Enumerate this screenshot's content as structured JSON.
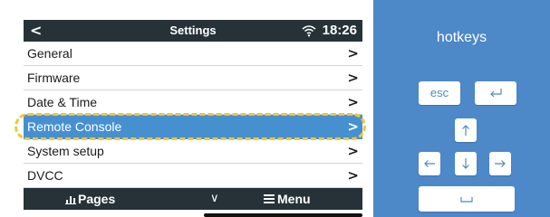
{
  "header": {
    "back_glyph": "<",
    "title": "Settings",
    "time": "18:26"
  },
  "menu": {
    "items": [
      {
        "label": "General",
        "chevron": ">"
      },
      {
        "label": "Firmware",
        "chevron": ">"
      },
      {
        "label": "Date & Time",
        "chevron": ">"
      },
      {
        "label": "Remote Console",
        "chevron": ">"
      },
      {
        "label": "System setup",
        "chevron": ">"
      },
      {
        "label": "DVCC",
        "chevron": ">"
      }
    ],
    "selected_index": 3
  },
  "footer": {
    "pages_label": "Pages",
    "caret_glyph": "∨",
    "menu_label": "Menu"
  },
  "hotkeys": {
    "title": "hotkeys",
    "esc_label": "esc"
  },
  "colors": {
    "bar_bg": "#263238",
    "selected_bg": "#4790d0",
    "hotkeys_bg": "#4d88c8",
    "highlight_ring": "#f2c631"
  },
  "icons": [
    "wifi-icon",
    "bar-chart-icon",
    "hamburger-icon",
    "return-icon",
    "arrow-up-icon",
    "arrow-left-icon",
    "arrow-down-icon",
    "arrow-right-icon",
    "space-icon"
  ]
}
